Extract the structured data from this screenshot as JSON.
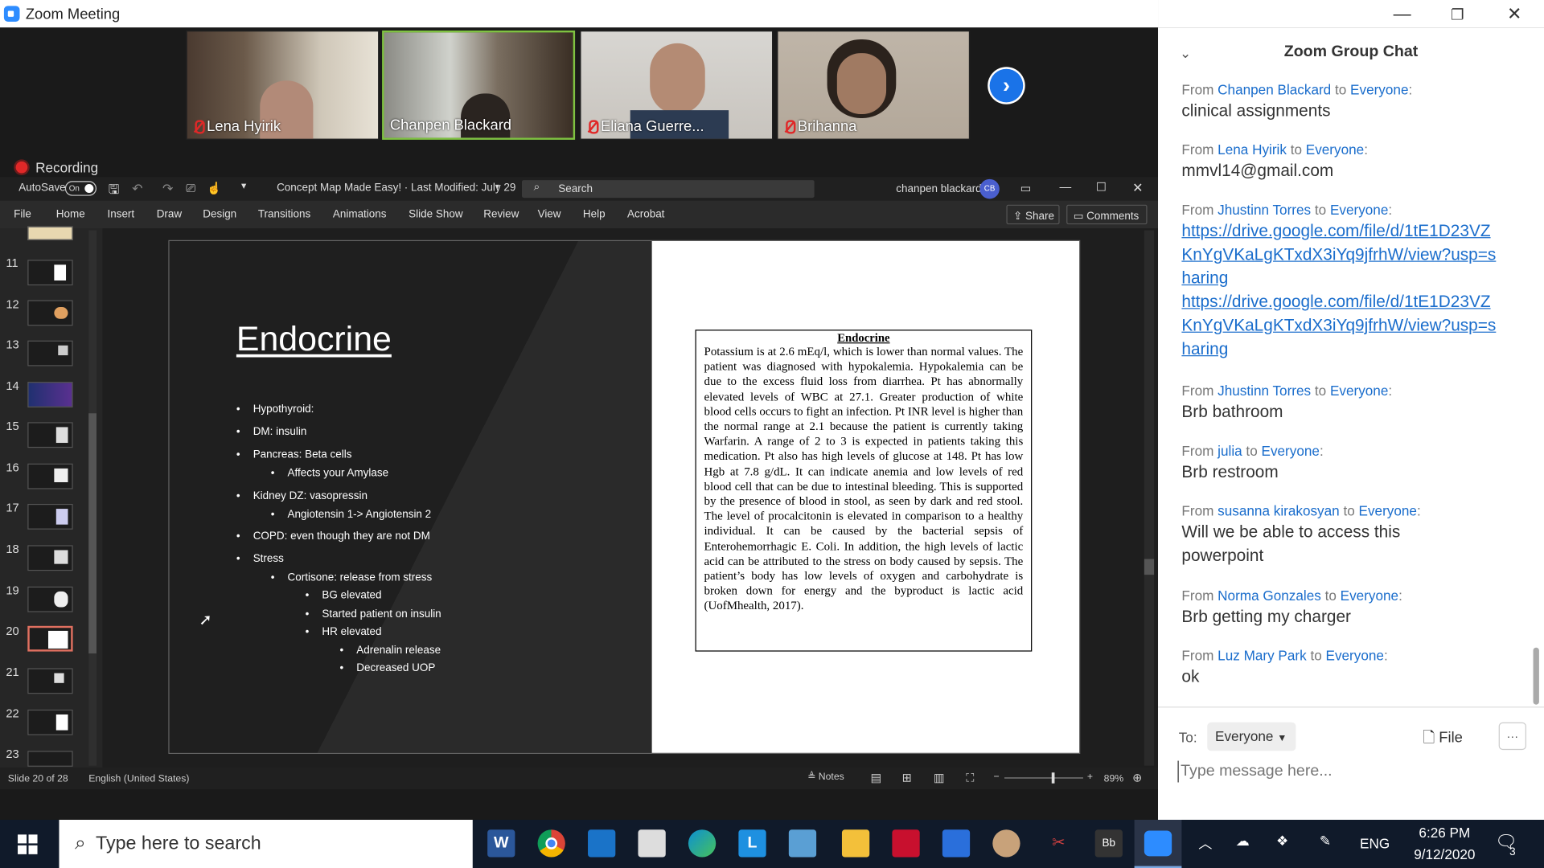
{
  "zoom": {
    "window_title": "Zoom Meeting",
    "recording_label": "Recording",
    "participants": [
      {
        "name": "Lena Hyirik",
        "muted": true,
        "active": false
      },
      {
        "name": "Chanpen Blackard",
        "muted": false,
        "active": true
      },
      {
        "name": "Eliana Guerre...",
        "muted": true,
        "active": false
      },
      {
        "name": "Brihanna",
        "muted": true,
        "active": false
      }
    ]
  },
  "ppt": {
    "autosave_label": "AutoSave",
    "autosave_state": "On",
    "doc_title": "Concept Map Made Easy! · Last Modified: July 29",
    "search_placeholder": "Search",
    "user_name": "chanpen blackard",
    "user_initials": "CB",
    "tabs": [
      "File",
      "Home",
      "Insert",
      "Draw",
      "Design",
      "Transitions",
      "Animations",
      "Slide Show",
      "Review",
      "View",
      "Help",
      "Acrobat"
    ],
    "share_label": "Share",
    "comments_label": "Comments",
    "thumb_numbers": [
      "11",
      "12",
      "13",
      "14",
      "15",
      "16",
      "17",
      "18",
      "19",
      "20",
      "21",
      "22",
      "23"
    ],
    "slide": {
      "title": "Endocrine",
      "bullets": [
        {
          "level": 1,
          "text": "Hypothyroid:"
        },
        {
          "level": 1,
          "text": "DM: insulin"
        },
        {
          "level": 1,
          "text": "Pancreas: Beta cells"
        },
        {
          "level": 2,
          "text": "Affects your Amylase"
        },
        {
          "level": 1,
          "text": "Kidney DZ: vasopressin"
        },
        {
          "level": 2,
          "text": "Angiotensin 1-> Angiotensin 2"
        },
        {
          "level": 1,
          "text": "COPD: even though they are not DM"
        },
        {
          "level": 1,
          "text": "Stress"
        },
        {
          "level": 2,
          "text": "Cortisone: release from stress"
        },
        {
          "level": 3,
          "text": "BG elevated"
        },
        {
          "level": 3,
          "text": "Started patient on insulin"
        },
        {
          "level": 3,
          "text": "HR elevated"
        },
        {
          "level": 4,
          "text": "Adrenalin release"
        },
        {
          "level": 4,
          "text": "Decreased UOP"
        }
      ],
      "doc_heading": "Endocrine",
      "doc_text": "Potassium is at 2.6 mEq/l, which is lower than normal values. The patient was diagnosed with hypokalemia. Hypokalemia can be due to the excess fluid loss from diarrhea. Pt has abnormally elevated levels of WBC at 27.1. Greater production of white blood cells occurs to fight an infection. Pt INR level is higher than the normal range at 2.1 because the patient is currently taking Warfarin. A range of 2 to 3 is expected in patients taking this medication. Pt also has high levels of glucose at 148. Pt has low Hgb at 7.8 g/dL. It can indicate anemia and low levels of red blood cell that can be due to intestinal bleeding. This is supported by the presence of blood in stool, as seen by dark and red stool. The level of procalcitonin is elevated in comparison to a healthy individual. It can be caused by the bacterial sepsis of Enterohemorrhagic E. Coli. In addition, the high levels of lactic acid can be attributed to the stress on body caused by sepsis. The patient’s body has low levels of oxygen and carbohydrate is broken down for energy and the byproduct is lactic acid (UofMhealth, 2017)."
    },
    "status": {
      "slide_indicator": "Slide 20 of 28",
      "language": "English (United States)",
      "notes_label": "Notes",
      "zoom_level": "89%",
      "zoom_fraction": 0.6
    }
  },
  "chat": {
    "title": "Zoom Group Chat",
    "messages": [
      {
        "from": "Chanpen Blackard",
        "to": "Everyone",
        "text": "clinical assignments"
      },
      {
        "from": "Lena Hyirik",
        "to": "Everyone",
        "text": "mmvl14@gmail.com"
      },
      {
        "from": "Jhustinn Torres",
        "to": "Everyone",
        "link1": "https://drive.google.com/file/d/1tE1D23VZKnYgVKaLgKTxdX3iYq9jfrhW/view?usp=sharing",
        "link2": "https://drive.google.com/file/d/1tE1D23VZKnYgVKaLgKTxdX3iYq9jfrhW/view?usp=sharing"
      },
      {
        "from": "Jhustinn Torres",
        "to": "Everyone",
        "text": "Brb bathroom"
      },
      {
        "from": "julia",
        "to": "Everyone",
        "text": "Brb restroom"
      },
      {
        "from": "susanna kirakosyan",
        "to": "Everyone",
        "text": "Will we be able to access this powerpoint"
      },
      {
        "from": "Norma Gonzales",
        "to": "Everyone",
        "text": "Brb getting my charger"
      },
      {
        "from": "Luz Mary Park",
        "to": "Everyone",
        "text": "ok"
      }
    ],
    "from_word": "From",
    "to_word": "to",
    "to_label": "To:",
    "to_value": "Everyone",
    "file_label": "File",
    "more_label": "···",
    "input_placeholder": "Type message here..."
  },
  "taskbar": {
    "search_placeholder": "Type here to search",
    "lang": "ENG",
    "time": "6:26 PM",
    "date": "9/12/2020",
    "notif_count": "3"
  },
  "colors": {
    "zoom_blue": "#2d8cff",
    "link": "#1a6dcc",
    "ppt_dark": "#2b2b2b",
    "mute_red": "#e02828"
  }
}
